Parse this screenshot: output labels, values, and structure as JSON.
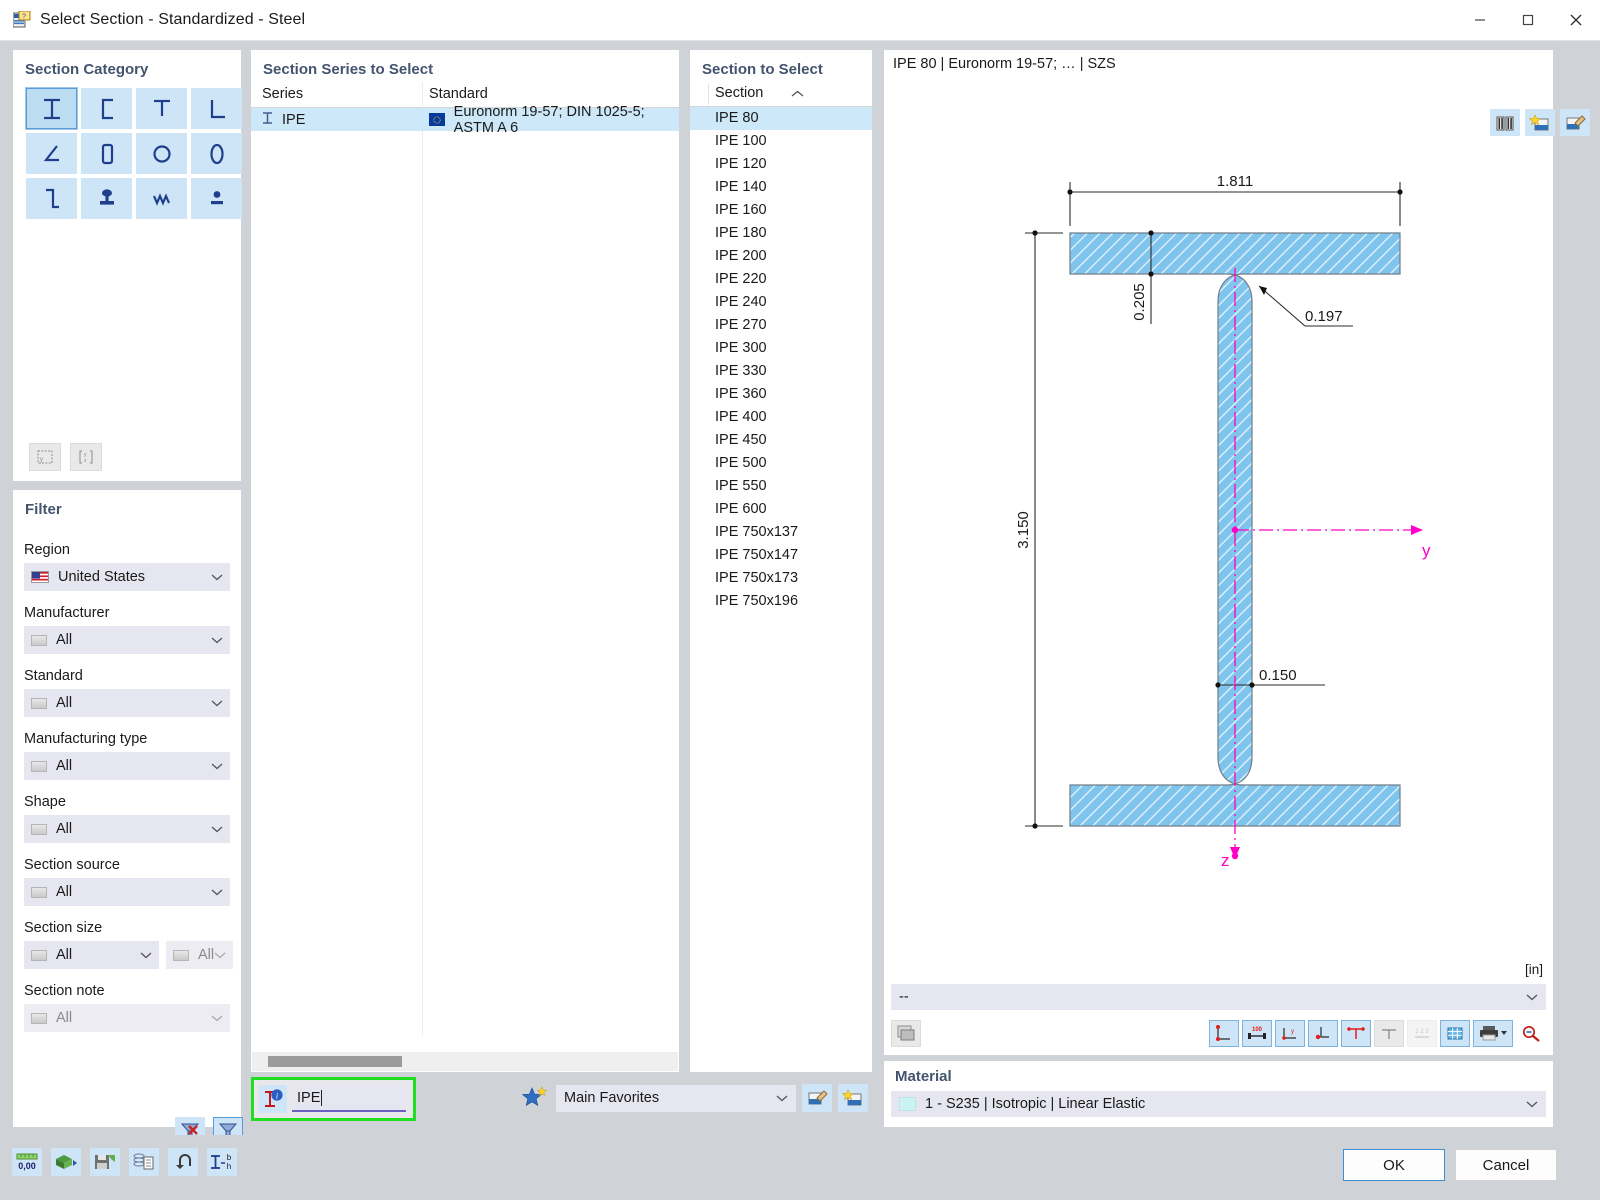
{
  "window": {
    "title": "Select Section - Standardized - Steel",
    "icon": "section-library-icon",
    "minimize": "minimize-icon",
    "maximize": "maximize-icon",
    "close": "close-icon"
  },
  "section_category": {
    "title": "Section Category",
    "items": [
      {
        "name": "i-section-icon",
        "selected": true
      },
      {
        "name": "channel-section-icon",
        "selected": false
      },
      {
        "name": "t-section-icon",
        "selected": false
      },
      {
        "name": "l-section-icon",
        "selected": false
      },
      {
        "name": "angle-section-icon",
        "selected": false
      },
      {
        "name": "rectangular-hollow-section-icon",
        "selected": false
      },
      {
        "name": "circular-hollow-section-icon",
        "selected": false
      },
      {
        "name": "oval-section-icon",
        "selected": false
      },
      {
        "name": "z-section-icon",
        "selected": false
      },
      {
        "name": "rail-section-icon",
        "selected": false
      },
      {
        "name": "corrugated-web-section-icon",
        "selected": false
      },
      {
        "name": "bar-section-icon",
        "selected": false
      }
    ],
    "footer_buttons": [
      {
        "name": "section-properties-icon"
      },
      {
        "name": "section-dimensions-icon"
      }
    ]
  },
  "filter": {
    "title": "Filter",
    "fields": [
      {
        "label": "Region",
        "value": "United States",
        "icon": "us-flag-icon",
        "disabled": false
      },
      {
        "label": "Manufacturer",
        "value": "All",
        "icon": "swatch-icon",
        "disabled": false
      },
      {
        "label": "Standard",
        "value": "All",
        "icon": "swatch-icon",
        "disabled": false
      },
      {
        "label": "Manufacturing type",
        "value": "All",
        "icon": "swatch-icon",
        "disabled": false
      },
      {
        "label": "Shape",
        "value": "All",
        "icon": "swatch-icon",
        "disabled": false
      },
      {
        "label": "Section source",
        "value": "All",
        "icon": "swatch-icon",
        "disabled": false
      },
      {
        "label": "Section size",
        "value": "All",
        "icon": "swatch-icon",
        "disabled": false,
        "value2": "All",
        "disabled2": true
      },
      {
        "label": "Section note",
        "value": "All",
        "icon": "swatch-icon",
        "disabled": true
      }
    ],
    "actions": [
      {
        "name": "clear-filter-button"
      },
      {
        "name": "apply-filter-button"
      }
    ]
  },
  "series_panel": {
    "title": "Section Series to Select",
    "columns": [
      "Series",
      "Standard"
    ],
    "rows": [
      {
        "series": "IPE",
        "standard": "Euronorm 19-57; DIN 1025-5; ASTM A 6",
        "selected": true
      }
    ]
  },
  "section_panel": {
    "title": "Section to Select",
    "column": "Section",
    "sort": "ascending",
    "items": [
      {
        "label": "IPE 80",
        "selected": true
      },
      {
        "label": "IPE 100",
        "selected": false
      },
      {
        "label": "IPE 120",
        "selected": false
      },
      {
        "label": "IPE 140",
        "selected": false
      },
      {
        "label": "IPE 160",
        "selected": false
      },
      {
        "label": "IPE 180",
        "selected": false
      },
      {
        "label": "IPE 200",
        "selected": false
      },
      {
        "label": "IPE 220",
        "selected": false
      },
      {
        "label": "IPE 240",
        "selected": false
      },
      {
        "label": "IPE 270",
        "selected": false
      },
      {
        "label": "IPE 300",
        "selected": false
      },
      {
        "label": "IPE 330",
        "selected": false
      },
      {
        "label": "IPE 360",
        "selected": false
      },
      {
        "label": "IPE 400",
        "selected": false
      },
      {
        "label": "IPE 450",
        "selected": false
      },
      {
        "label": "IPE 500",
        "selected": false
      },
      {
        "label": "IPE 550",
        "selected": false
      },
      {
        "label": "IPE 600",
        "selected": false
      },
      {
        "label": "IPE 750x137",
        "selected": false
      },
      {
        "label": "IPE 750x147",
        "selected": false
      },
      {
        "label": "IPE 750x173",
        "selected": false
      },
      {
        "label": "IPE 750x196",
        "selected": false
      }
    ]
  },
  "drawing": {
    "header": "IPE 80 | Euronorm 19-57; … | SZS",
    "unit": "[in]",
    "combo_value": "--",
    "dimensions": {
      "width": "1.811",
      "height": "3.150",
      "flange_thickness": "0.205",
      "root_radius": "0.197",
      "web_thickness": "0.150"
    },
    "axes": {
      "y": "y",
      "z": "z"
    },
    "tools": [
      {
        "name": "dimension-lines-tool",
        "state": "active"
      },
      {
        "name": "dimension-values-tool",
        "state": "active"
      },
      {
        "name": "angle-dimension-tool",
        "state": "active"
      },
      {
        "name": "radius-dimension-tool",
        "state": "active"
      },
      {
        "name": "axes-dimension-tool",
        "state": "active"
      },
      {
        "name": "centerline-tool",
        "state": "flat"
      },
      {
        "name": "numbering-tool",
        "state": "disabled"
      },
      {
        "name": "grid-tool",
        "state": "active"
      },
      {
        "name": "print-tool",
        "state": "active"
      },
      {
        "name": "zoom-reset-tool",
        "state": "plain"
      }
    ],
    "image_button": {
      "name": "render-image-button"
    }
  },
  "material": {
    "title": "Material",
    "value": "1 - S235 | Isotropic | Linear Elastic",
    "buttons": [
      {
        "name": "material-library-button"
      },
      {
        "name": "new-material-button"
      },
      {
        "name": "edit-material-button"
      }
    ]
  },
  "search": {
    "icon": "section-info-icon",
    "value": "IPE",
    "placeholder": ""
  },
  "favorites": {
    "icon": "favorites-star-icon",
    "value": "Main Favorites",
    "buttons": [
      {
        "name": "manage-favorites-button"
      },
      {
        "name": "add-to-favorites-button"
      }
    ]
  },
  "bottom_tools": [
    {
      "name": "units-button"
    },
    {
      "name": "import-button"
    },
    {
      "name": "save-button"
    },
    {
      "name": "copy-button"
    },
    {
      "name": "undo-button"
    },
    {
      "name": "dimension-settings-button"
    }
  ],
  "dialog_buttons": {
    "ok": "OK",
    "cancel": "Cancel"
  },
  "colors": {
    "accent": "#44546f",
    "section_fill": "#7fc4ec",
    "selection": "#cde8f8",
    "focus_outline": "#22dd22",
    "axis_magenta": "#ff00c8"
  }
}
